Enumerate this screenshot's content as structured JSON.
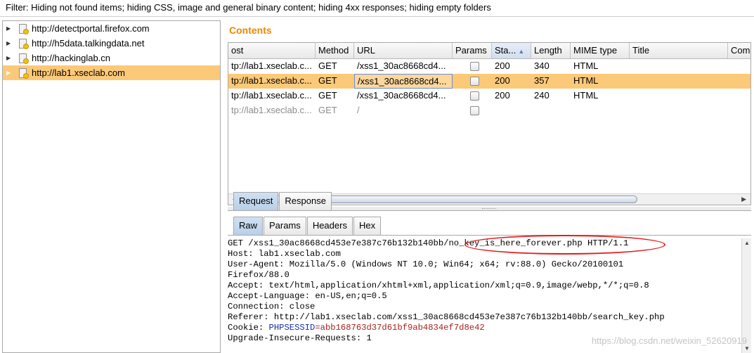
{
  "filter_text": "Filter: Hiding not found items;  hiding CSS, image and general binary content;  hiding 4xx responses;  hiding empty folders",
  "tree": [
    {
      "label": "http://detectportal.firefox.com",
      "selected": false
    },
    {
      "label": "http://h5data.talkingdata.net",
      "selected": false
    },
    {
      "label": "http://hackinglab.cn",
      "selected": false
    },
    {
      "label": "http://lab1.xseclab.com",
      "selected": true
    }
  ],
  "contents": {
    "title": "Contents",
    "columns": {
      "host": "ost",
      "method": "Method",
      "url": "URL",
      "params": "Params",
      "status": "Sta...",
      "length": "Length",
      "mime": "MIME type",
      "title": "Title",
      "comment": "Com"
    },
    "rows": [
      {
        "host": "tp://lab1.xseclab.c...",
        "method": "GET",
        "url": "/xss1_30ac8668cd4...",
        "status": "200",
        "length": "340",
        "mime": "HTML"
      },
      {
        "host": "tp://lab1.xseclab.c...",
        "method": "GET",
        "url": "/xss1_30ac8668cd4...",
        "status": "200",
        "length": "357",
        "mime": "HTML"
      },
      {
        "host": "tp://lab1.xseclab.c...",
        "method": "GET",
        "url": "/xss1_30ac8668cd4...",
        "status": "200",
        "length": "240",
        "mime": "HTML"
      },
      {
        "host": "tp://lab1.xseclab.c...",
        "method": "GET",
        "url": "/",
        "status": "",
        "length": "",
        "mime": ""
      }
    ]
  },
  "tabs_top": {
    "request": "Request",
    "response": "Response"
  },
  "tabs_sub": {
    "raw": "Raw",
    "params": "Params",
    "headers": "Headers",
    "hex": "Hex"
  },
  "raw": {
    "line1": "GET /xss1_30ac8668cd453e7e387c76b132b140bb/no_key_is_here_forever.php HTTP/1.1",
    "line2": "Host: lab1.xseclab.com",
    "line3": "User-Agent: Mozilla/5.0 (Windows NT 10.0; Win64; x64; rv:88.0) Gecko/20100101",
    "line4": "Firefox/88.0",
    "line5": "Accept: text/html,application/xhtml+xml,application/xml;q=0.9,image/webp,*/*;q=0.8",
    "line6": "Accept-Language: en-US,en;q=0.5",
    "line7": "Connection: close",
    "line8": "Referer: http://lab1.xseclab.com/xss1_30ac8668cd453e7e387c76b132b140bb/search_key.php",
    "line9_prefix": "Cookie: ",
    "cookie_key": "PHPSESSID",
    "cookie_value": "=abb168763d37d61bf9ab4834ef7d8e42",
    "line10": "Upgrade-Insecure-Requests: 1"
  },
  "watermark": "https://blog.csdn.net/weixin_52620919",
  "colors": {
    "selection": "#fcc979",
    "contents_title": "#e58a00",
    "annotation": "#e41e1e"
  }
}
